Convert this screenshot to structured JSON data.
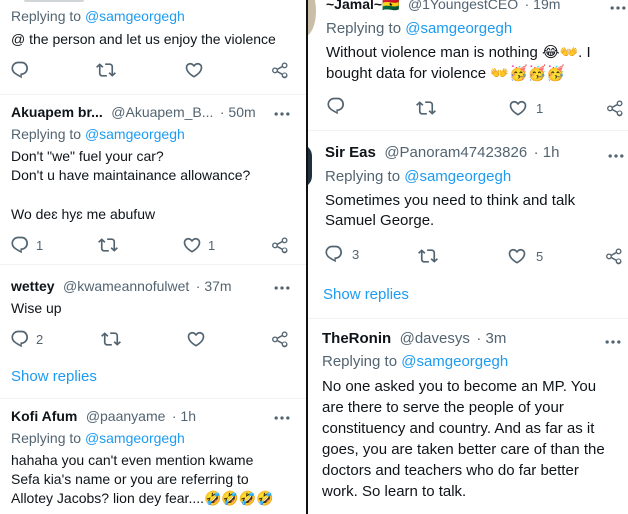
{
  "left": {
    "t1": {
      "reply_prefix": "Replying to ",
      "reply_to": "@samgeorgegh",
      "text": "@ the person and let us enjoy the violence"
    },
    "t2": {
      "name": "Akuapem br...",
      "handle": "@Akuapem_B...",
      "time": "· 50m",
      "reply_prefix": "Replying to ",
      "reply_to": "@samgeorgegh",
      "line1": "Don't \"we\" fuel your car?",
      "line2": "Don't u have maintainance allowance?",
      "line3": "Wo deɛ hyɛ me abufuw",
      "reply_count": "1",
      "like_count": "1"
    },
    "t3": {
      "name": "wettey",
      "handle": "@kwameannofulwet",
      "time": "· 37m",
      "text": "Wise up",
      "reply_count": "2"
    },
    "show_replies": "Show replies",
    "t4": {
      "name": "Kofi Afum",
      "handle": "@paanyame",
      "time": "· 1h",
      "reply_prefix": "Replying to ",
      "reply_to": "@samgeorgegh",
      "line1": "hahaha you can't even mention kwame",
      "line2": "Sefa kia's name or you are referring to",
      "line3": "Allotey Jacobs? lion dey fear....🤣🤣🤣🤣"
    }
  },
  "right": {
    "t1": {
      "name": "~Jamal~🇬🇭",
      "handle": "@1YoungestCEO",
      "time": "· 19m",
      "reply_prefix": "Replying to ",
      "reply_to": "@samgeorgegh",
      "line1": "Without violence man is nothing 😂👐. I",
      "line2": "bought data for violence 👐🥳🥳🥳",
      "like_count": "1"
    },
    "t2": {
      "name": "Sir Eas",
      "handle": "@Panoram47423826",
      "time": "· 1h",
      "reply_prefix": "Replying to ",
      "reply_to": "@samgeorgegh",
      "line1": "Sometimes you need to think and talk",
      "line2": "Samuel George.",
      "reply_count": "3",
      "like_count": "5"
    },
    "show_replies": "Show replies",
    "t3": {
      "name": "TheRonin",
      "handle": "@davesys",
      "time": "· 3m",
      "reply_prefix": "Replying to ",
      "reply_to": "@samgeorgegh",
      "line1": "No one asked you to become an MP. You",
      "line2": "are there to serve the people of your",
      "line3": "constituency and country. And as far as it",
      "line4": "goes, you are taken better care of than the",
      "line5": "doctors and teachers who do far better",
      "line6": "work. So learn to talk."
    }
  }
}
